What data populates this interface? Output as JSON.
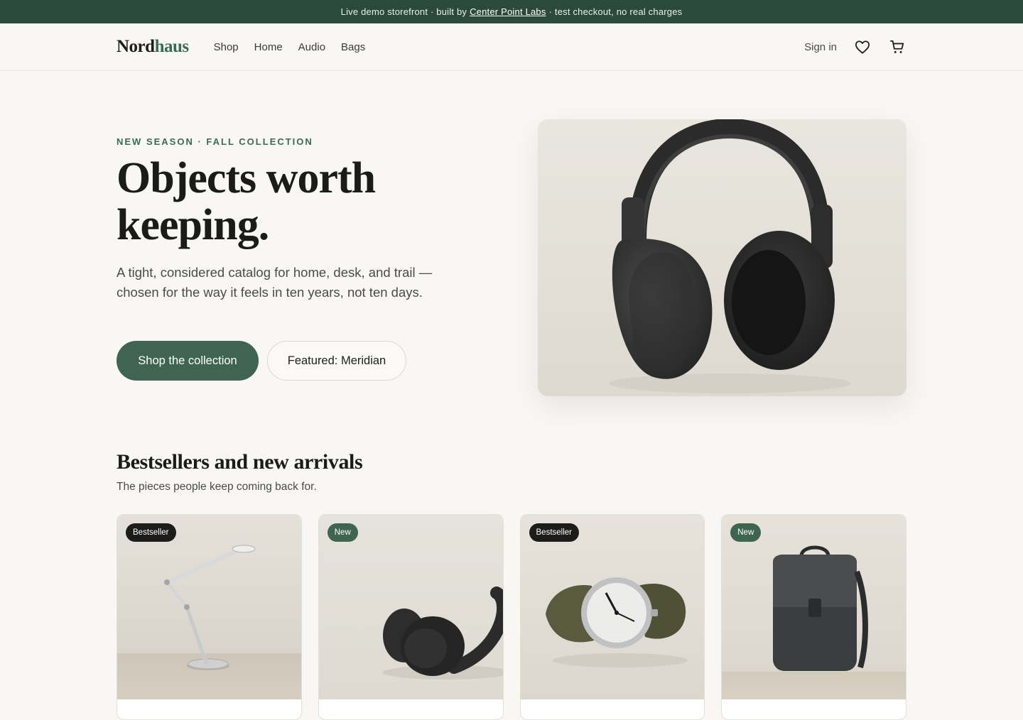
{
  "announcement": {
    "prefix": "Live demo storefront · built by",
    "link": "Center Point Labs",
    "suffix": "· test checkout, no real charges"
  },
  "header": {
    "logo_a": "Nord",
    "logo_b": "haus",
    "nav": [
      "Shop",
      "Home",
      "Audio",
      "Bags"
    ],
    "sign_in": "Sign in",
    "icons": [
      "heart-icon",
      "cart-icon"
    ]
  },
  "hero": {
    "eyebrow": "NEW SEASON · FALL COLLECTION",
    "title": "Objects worth keeping.",
    "subtitle": "A tight, considered catalog for home, desk, and trail — chosen for the way it feels in ten years, not ten days.",
    "primary_cta": "Shop the collection",
    "secondary_cta": "Featured: Meridian"
  },
  "section": {
    "title": "Bestsellers and new arrivals",
    "subtitle": "The pieces people keep coming back for."
  },
  "products": [
    {
      "badge": "Bestseller",
      "badge_style": "dark",
      "image": "desk-lamp"
    },
    {
      "badge": "New",
      "badge_style": "green",
      "image": "headphones"
    },
    {
      "badge": "Bestseller",
      "badge_style": "dark",
      "image": "watch"
    },
    {
      "badge": "New",
      "badge_style": "green",
      "image": "backpack"
    }
  ],
  "colors": {
    "accent": "#3f6550",
    "announcement_bg": "#2c4a3c",
    "page_bg": "#f8f7f4"
  }
}
